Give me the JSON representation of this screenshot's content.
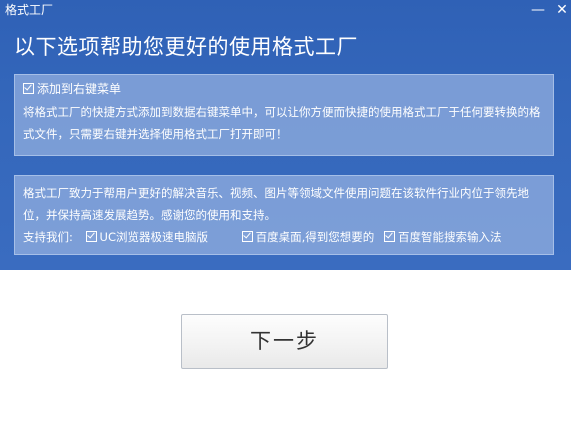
{
  "window": {
    "title": "格式工厂",
    "minimize_label": "—",
    "close_label": "✕"
  },
  "heading": "以下选项帮助您更好的使用格式工厂",
  "context_menu": {
    "checked": true,
    "label": "添加到右键菜单",
    "description": "将格式工厂的快捷方式添加到数据右键菜单中，可以让你方便而快捷的使用格式工厂于任何要转换的格式文件，只需要右键并选择使用格式工厂打开即可！"
  },
  "about": {
    "text": "格式工厂致力于帮用户更好的解决音乐、视频、图片等领域文件使用问题在该软件行业内位于领先地位，并保持高速发展趋势。感谢您的使用和支持。",
    "support_label": "支持我们:",
    "support_items": [
      {
        "label": "UC浏览器极速电脑版",
        "checked": true
      },
      {
        "label": "百度桌面,得到您想要的",
        "checked": true
      },
      {
        "label": "百度智能搜索输入法",
        "checked": true
      }
    ]
  },
  "next_button": "下一步",
  "colors": {
    "header_background": "#3467bb",
    "panel_background": "#96b2e0",
    "page_background": "#ffffff",
    "button_text": "#333333"
  }
}
